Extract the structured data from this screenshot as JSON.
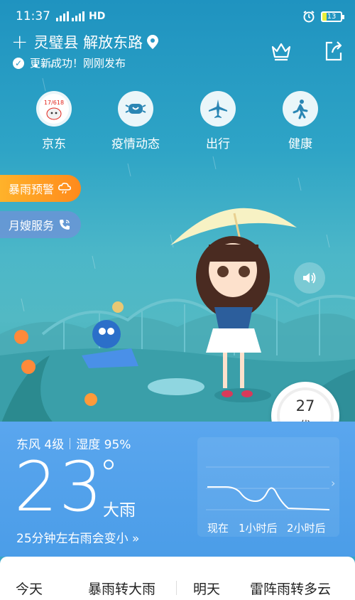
{
  "status_bar": {
    "time": "11:37",
    "net1": "4G",
    "net2": "4G",
    "hd": "HD",
    "battery": "13"
  },
  "header": {
    "location": "灵璧县 解放东路",
    "update_text": "更新成功！刚刚发布"
  },
  "quick_entries": [
    {
      "label": "京东",
      "icon": "jd-icon"
    },
    {
      "label": "疫情动态",
      "icon": "mask-icon"
    },
    {
      "label": "出行",
      "icon": "plane-icon"
    },
    {
      "label": "健康",
      "icon": "walking-icon"
    }
  ],
  "jd_badge": "17/618",
  "pills": {
    "warning": "暴雨预警",
    "service": "月嫂服务"
  },
  "aqi": {
    "value": "27",
    "level": "优",
    "level_fraction": 0.27
  },
  "current": {
    "wind": "东风 4级",
    "humidity": "湿度 95%",
    "temperature": "23",
    "degree": "°",
    "condition": "大雨",
    "rain_message": "25分钟左右雨会变小",
    "rain_arrow": "»"
  },
  "rain_chart": {
    "labels": [
      "现在",
      "1小时后",
      "2小时后"
    ],
    "arrow": "›"
  },
  "forecast": {
    "today_label": "今天",
    "today_cond": "暴雨转大雨",
    "tomorrow_label": "明天",
    "tomorrow_cond": "雷阵雨转多云"
  },
  "colors": {
    "warning_pill": "#ff9a22",
    "panel_blue": "#5aa6ee",
    "aqi_green": "#4cc98a"
  }
}
